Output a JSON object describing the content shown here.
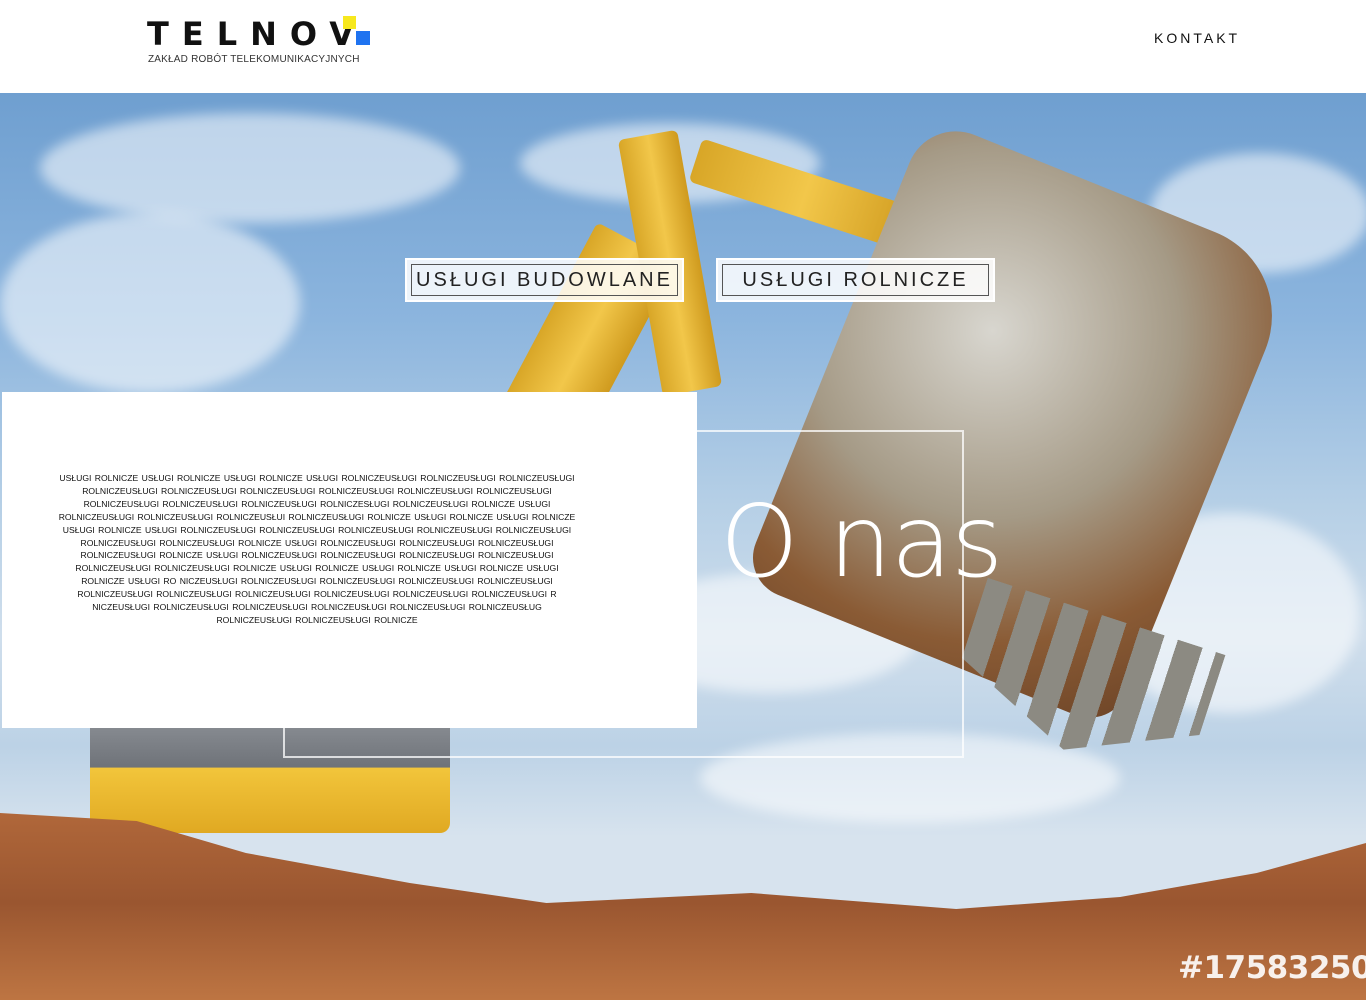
{
  "header": {
    "logo_text": "TELNOV",
    "tagline": "ZAKŁAD ROBÓT TELEKOMUNIKACYJNYCH",
    "nav_contact": "KONTAKT",
    "accent_yellow": "#f7e81e",
    "accent_blue": "#1f73f0"
  },
  "hero": {
    "buttons": {
      "budowlane": "USŁUGI BUDOWLANE",
      "rolnicze": "USŁUGI ROLNICZE"
    },
    "heading": "O nas",
    "panel_text": "USŁUGI ROLNICZE USŁUGI ROLNICZE USŁUGI ROLNICZE USŁUGI ROLNICZEUSŁUGI ROLNICZEUSŁUGI ROLNICZEUSŁUGI ROLNICZEUSŁUGI ROLNICZEUSŁUGI ROLNICZEUSŁUGI ROLNICZEUSŁUGI ROLNICZEUSŁUGI ROLNICZEUSŁUGI ROLNICZEUSŁUGI ROLNICZEUSŁUGI ROLNICZEUSŁUGI ROLNICZESŁUGI ROLNICZEUSŁUGI ROLNICZE USŁUGI ROLNICZEUSŁUGI ROLNICZEUSŁUGI ROLNICZEUSŁUI ROLNICZEUSŁUGI ROLNICZE USŁUGI ROLNICZE USŁUGI ROLNICZE USŁUGI ROLNICZE USŁUGI ROLNICZEUSŁUGI ROLNICZEUSŁUGI ROLNICZEUSŁUGI ROLNICZEUSŁUGI ROLNICZEUSŁUGI ROLNICZEUSŁUGI ROLNICZEUSŁUGI ROLNICZE USŁUGI ROLNICZEUSŁUGI ROLNICZEUSŁUGI ROLNICZEUSŁUGI ROLNICZEUSŁUGI ROLNICZE USŁUGI ROLNICZEUSŁUGI ROLNICZEUSŁUGI ROLNICZEUSŁUGI ROLNICZEUSŁUGI ROLNICZEUSŁUGI ROLNICZEUSŁUGI ROLNICZE USŁUGI ROLNICZE USŁUGI ROLNICZE USŁUGI ROLNICZE USŁUGI ROLNICZE USŁUGI RO NICZEUSŁUGI ROLNICZEUSŁUGI ROLNICZEUSŁUGI ROLNICZEUSŁUGI ROLNICZEUSŁUGI ROLNICZEUSŁUGI ROLNICZEUSŁUGI ROLNICZEUSŁUGI ROLNICZEUSŁUGI ROLNICZEUSŁUGI ROLNICZEUSŁUGI R NICZEUSŁUGI ROLNICZEUSŁUGI ROLNICZEUSŁUGI ROLNICZEUSŁUGI ROLNICZEUSŁUGI ROLNICZEUSŁUG ROLNICZEUSŁUGI ROLNICZEUSŁUGI ROLNICZE",
    "watermark": "#17583250"
  }
}
